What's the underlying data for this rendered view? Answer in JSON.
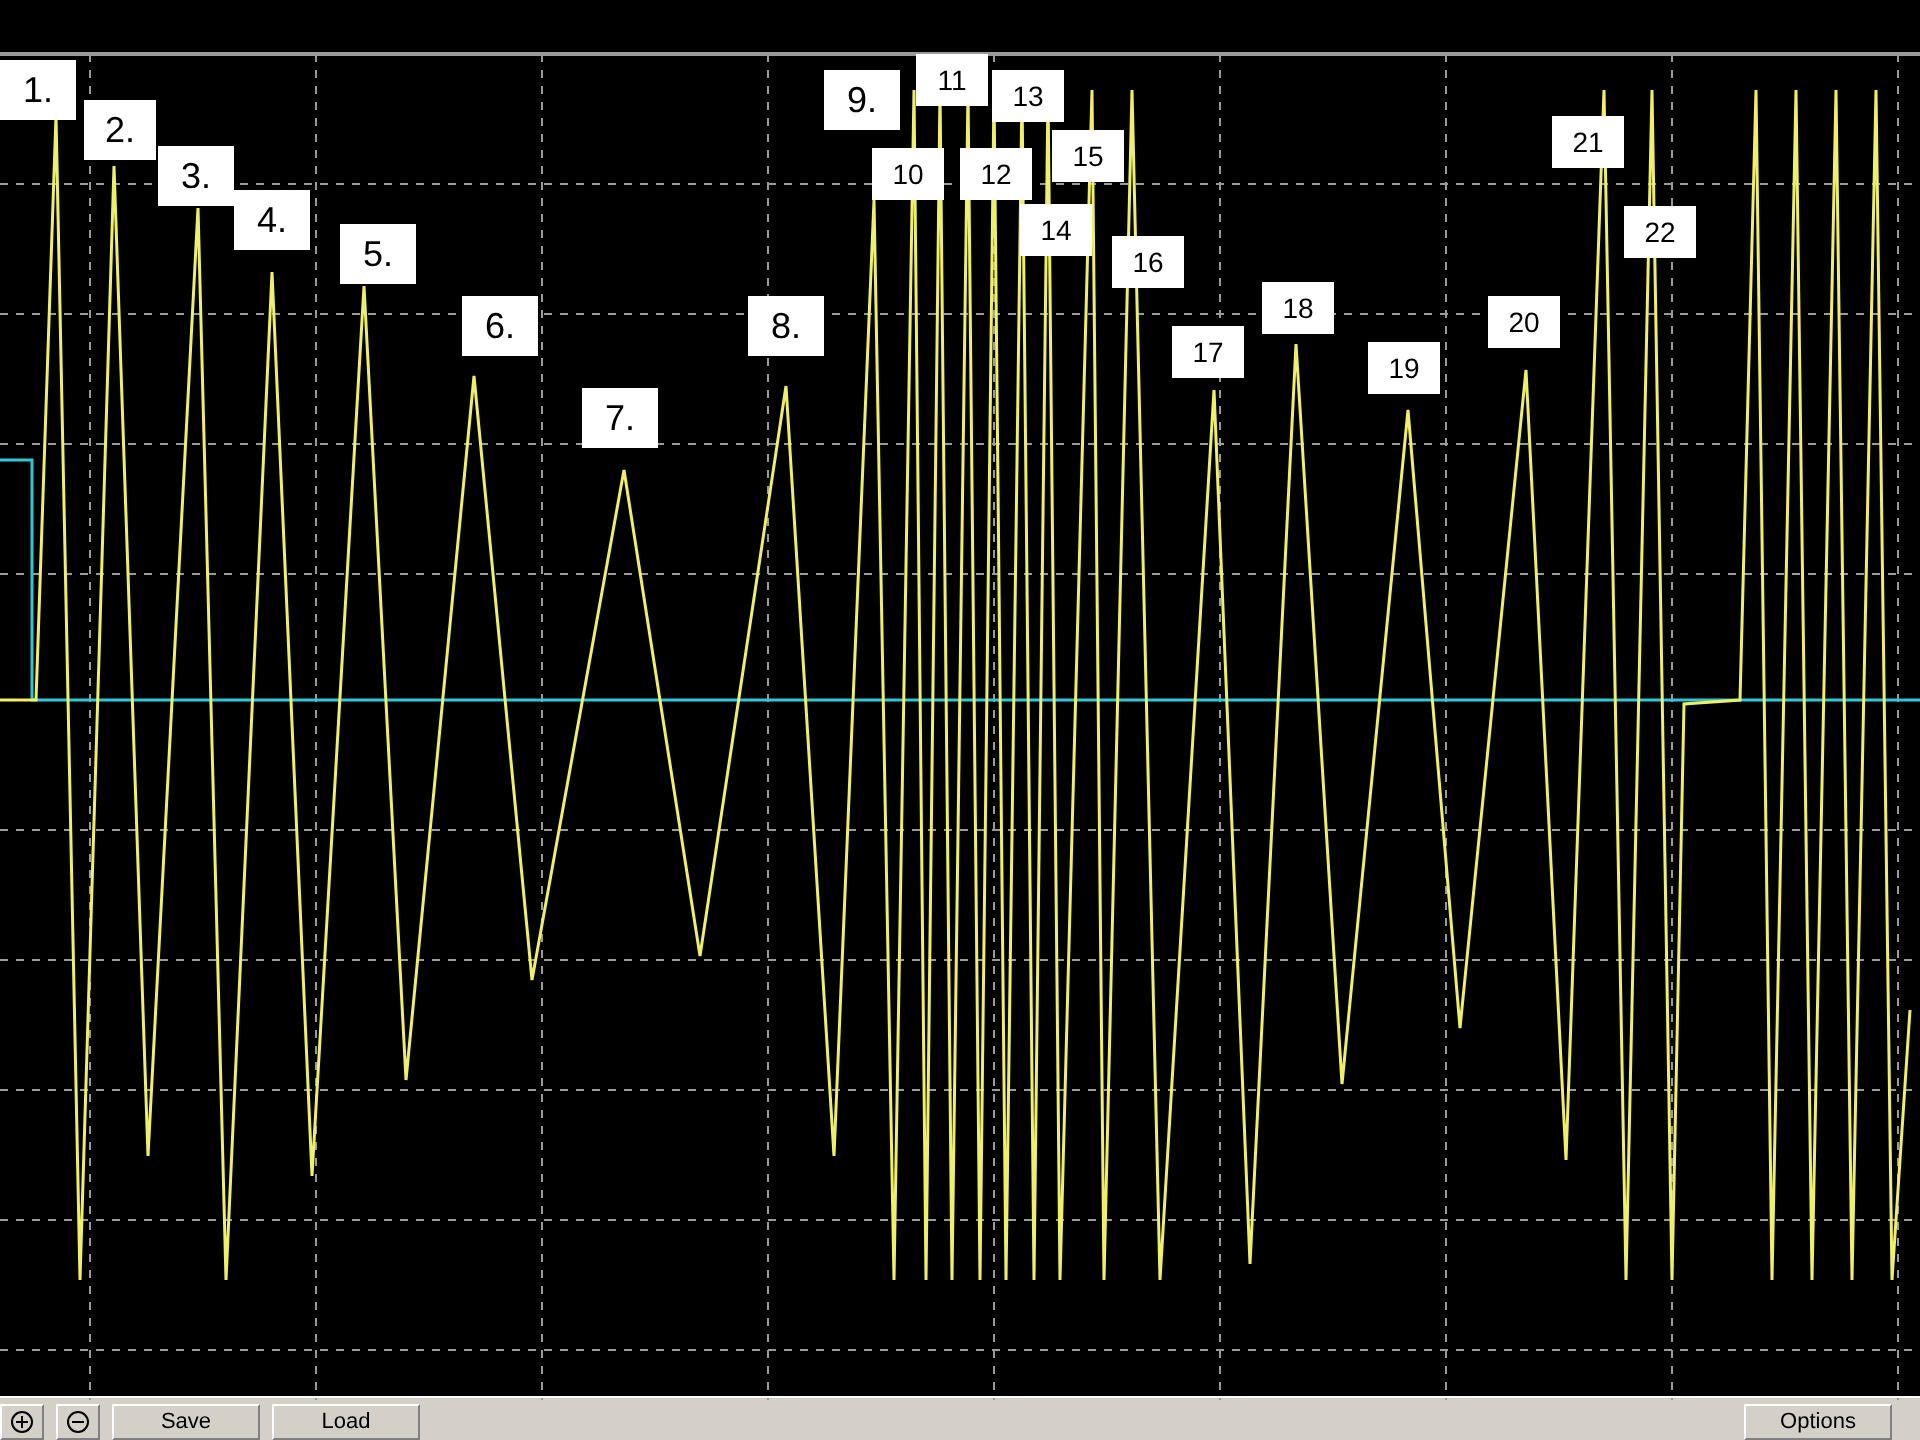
{
  "peak_labels": [
    "1.",
    "2.",
    "3.",
    "4.",
    "5.",
    "6.",
    "7.",
    "8.",
    "9.",
    "10",
    "11",
    "12",
    "13",
    "14",
    "15",
    "16",
    "17",
    "18",
    "19",
    "20",
    "21",
    "22"
  ],
  "toolbar": {
    "buttons": [
      {
        "kind": "zoom-in"
      },
      {
        "kind": "zoom-out"
      },
      {
        "kind": "text",
        "label": "Save"
      },
      {
        "kind": "text",
        "label": "Load"
      },
      {
        "kind": "spacer"
      },
      {
        "kind": "text",
        "label": "Options"
      }
    ]
  }
}
